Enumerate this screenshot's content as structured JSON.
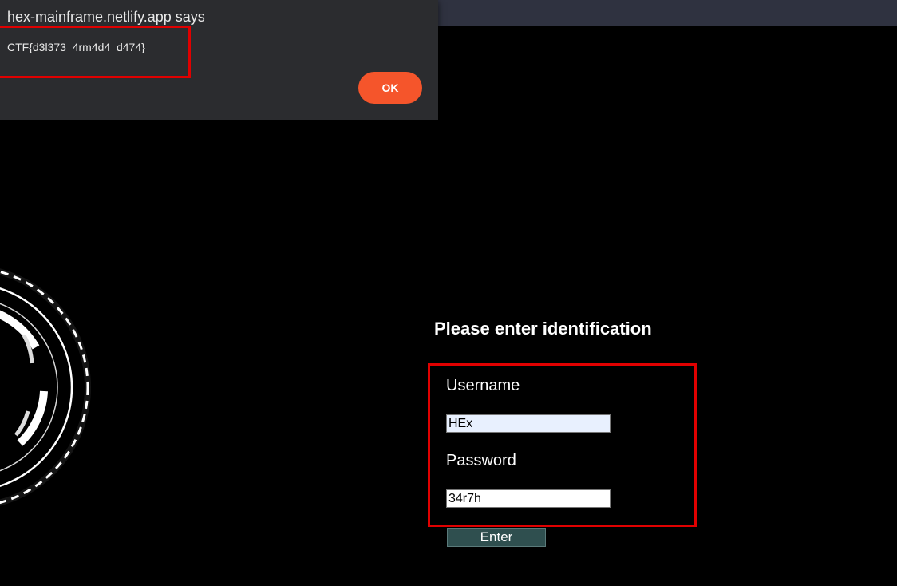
{
  "dialog": {
    "title": "hex-mainframe.netlify.app says",
    "message": "CTF{d3l373_4rm4d4_d474}",
    "ok_label": "OK"
  },
  "form": {
    "heading": "Please enter identification",
    "username_label": "Username",
    "username_value": "HEx",
    "password_label": "Password",
    "password_value": "34r7h",
    "enter_label": "Enter"
  },
  "colors": {
    "background": "#000000",
    "dialog_bg": "#2b2c2f",
    "ok_button": "#f5552b",
    "highlight": "#e00000",
    "enter_button": "#2f4f4f"
  }
}
